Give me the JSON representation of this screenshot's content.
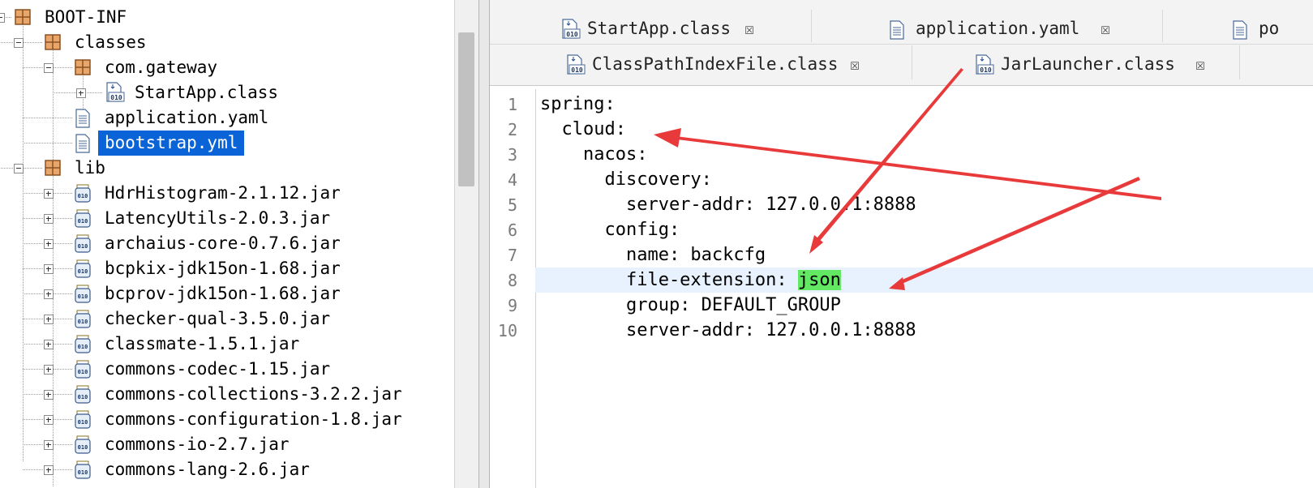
{
  "tree": {
    "items": [
      {
        "label": "BOOT-INF",
        "icon": "package-icon"
      },
      {
        "label": "classes",
        "icon": "package-icon"
      },
      {
        "label": "com.gateway",
        "icon": "package-icon"
      },
      {
        "label": "StartApp.class",
        "icon": "class-file-icon"
      },
      {
        "label": "application.yaml",
        "icon": "text-file-icon"
      },
      {
        "label": "bootstrap.yml",
        "icon": "text-file-icon",
        "selected": true
      },
      {
        "label": "lib",
        "icon": "package-icon"
      },
      {
        "label": "HdrHistogram-2.1.12.jar",
        "icon": "jar-icon"
      },
      {
        "label": "LatencyUtils-2.0.3.jar",
        "icon": "jar-icon"
      },
      {
        "label": "archaius-core-0.7.6.jar",
        "icon": "jar-icon"
      },
      {
        "label": "bcpkix-jdk15on-1.68.jar",
        "icon": "jar-icon"
      },
      {
        "label": "bcprov-jdk15on-1.68.jar",
        "icon": "jar-icon"
      },
      {
        "label": "checker-qual-3.5.0.jar",
        "icon": "jar-icon"
      },
      {
        "label": "classmate-1.5.1.jar",
        "icon": "jar-icon"
      },
      {
        "label": "commons-codec-1.15.jar",
        "icon": "jar-icon"
      },
      {
        "label": "commons-collections-3.2.2.jar",
        "icon": "jar-icon"
      },
      {
        "label": "commons-configuration-1.8.jar",
        "icon": "jar-icon"
      },
      {
        "label": "commons-io-2.7.jar",
        "icon": "jar-icon"
      },
      {
        "label": "commons-lang-2.6.jar",
        "icon": "jar-icon"
      }
    ]
  },
  "tabs": {
    "row1": [
      {
        "label": "StartApp.class",
        "icon": "class-file-icon"
      },
      {
        "label": "application.yaml",
        "icon": "text-file-icon"
      },
      {
        "label": "po",
        "icon": "text-file-icon"
      }
    ],
    "row2": [
      {
        "label": "ClassPathIndexFile.class",
        "icon": "class-file-icon"
      },
      {
        "label": "JarLauncher.class",
        "icon": "class-file-icon"
      }
    ],
    "close_glyph": "☒"
  },
  "editor": {
    "lines": [
      {
        "num": "1",
        "text": "spring:"
      },
      {
        "num": "2",
        "text": "  cloud:"
      },
      {
        "num": "3",
        "text": "    nacos:"
      },
      {
        "num": "4",
        "text": "      discovery:"
      },
      {
        "num": "5",
        "text": "        server-addr: 127.0.0.1:8888"
      },
      {
        "num": "6",
        "text": "      config:"
      },
      {
        "num": "7",
        "text": "        name: backcfg"
      },
      {
        "num": "8",
        "text": "        file-extension: ",
        "highlight": "json"
      },
      {
        "num": "9",
        "text": "        group: DEFAULT_GROUP"
      },
      {
        "num": "10",
        "text": "        server-addr: 127.0.0.1:8888"
      }
    ],
    "current_line_color": "#e8f2fe",
    "match_color": "#62e862"
  },
  "annotation_color": "#e83a3a"
}
